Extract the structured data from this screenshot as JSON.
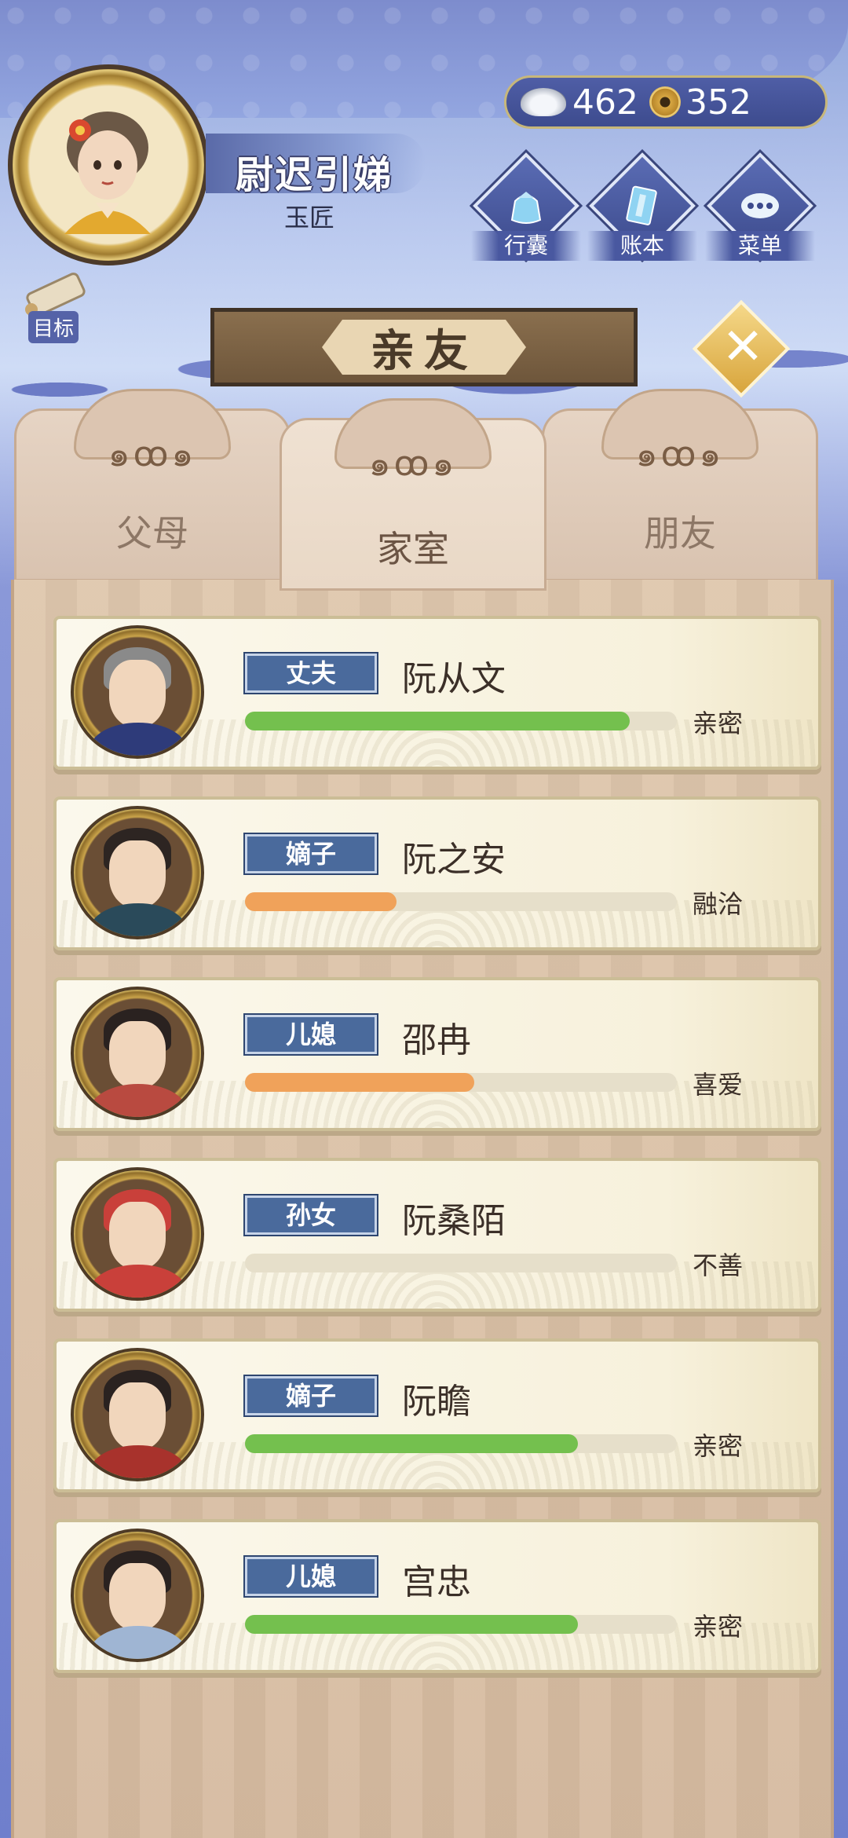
{
  "player": {
    "name": "尉迟引娣",
    "job": "玉匠"
  },
  "currency": {
    "silver": "462",
    "copper": "352"
  },
  "menu": {
    "bag_label": "行囊",
    "ledger_label": "账本",
    "menu_label": "菜单"
  },
  "goal_label": "目标",
  "title": "亲友",
  "tabs": [
    {
      "label": "父母"
    },
    {
      "label": "家室"
    },
    {
      "label": "朋友"
    }
  ],
  "members": [
    {
      "role": "丈夫",
      "name": "阮从文",
      "relation": "亲密",
      "affinity": 0.89,
      "bar_color": "#74c04e",
      "hair": "#8a8a8a",
      "robe": "#2e3b7a"
    },
    {
      "role": "嫡子",
      "name": "阮之安",
      "relation": "融洽",
      "affinity": 0.35,
      "bar_color": "#f0a25a",
      "hair": "#2d2522",
      "robe": "#2a4a5a"
    },
    {
      "role": "儿媳",
      "name": "邵冉",
      "relation": "喜爱",
      "affinity": 0.53,
      "bar_color": "#f0a25a",
      "hair": "#2a2220",
      "robe": "#b94a40"
    },
    {
      "role": "孙女",
      "name": "阮桑陌",
      "relation": "不善",
      "affinity": 0.0,
      "bar_color": "#f0a25a",
      "hair": "#c9403a",
      "robe": "#c9403a"
    },
    {
      "role": "嫡子",
      "name": "阮瞻",
      "relation": "亲密",
      "affinity": 0.77,
      "bar_color": "#74c04e",
      "hair": "#2a2220",
      "robe": "#a8322c"
    },
    {
      "role": "儿媳",
      "name": "宫忠",
      "relation": "亲密",
      "affinity": 0.77,
      "bar_color": "#74c04e",
      "hair": "#2a2220",
      "robe": "#9fb5d3"
    }
  ]
}
